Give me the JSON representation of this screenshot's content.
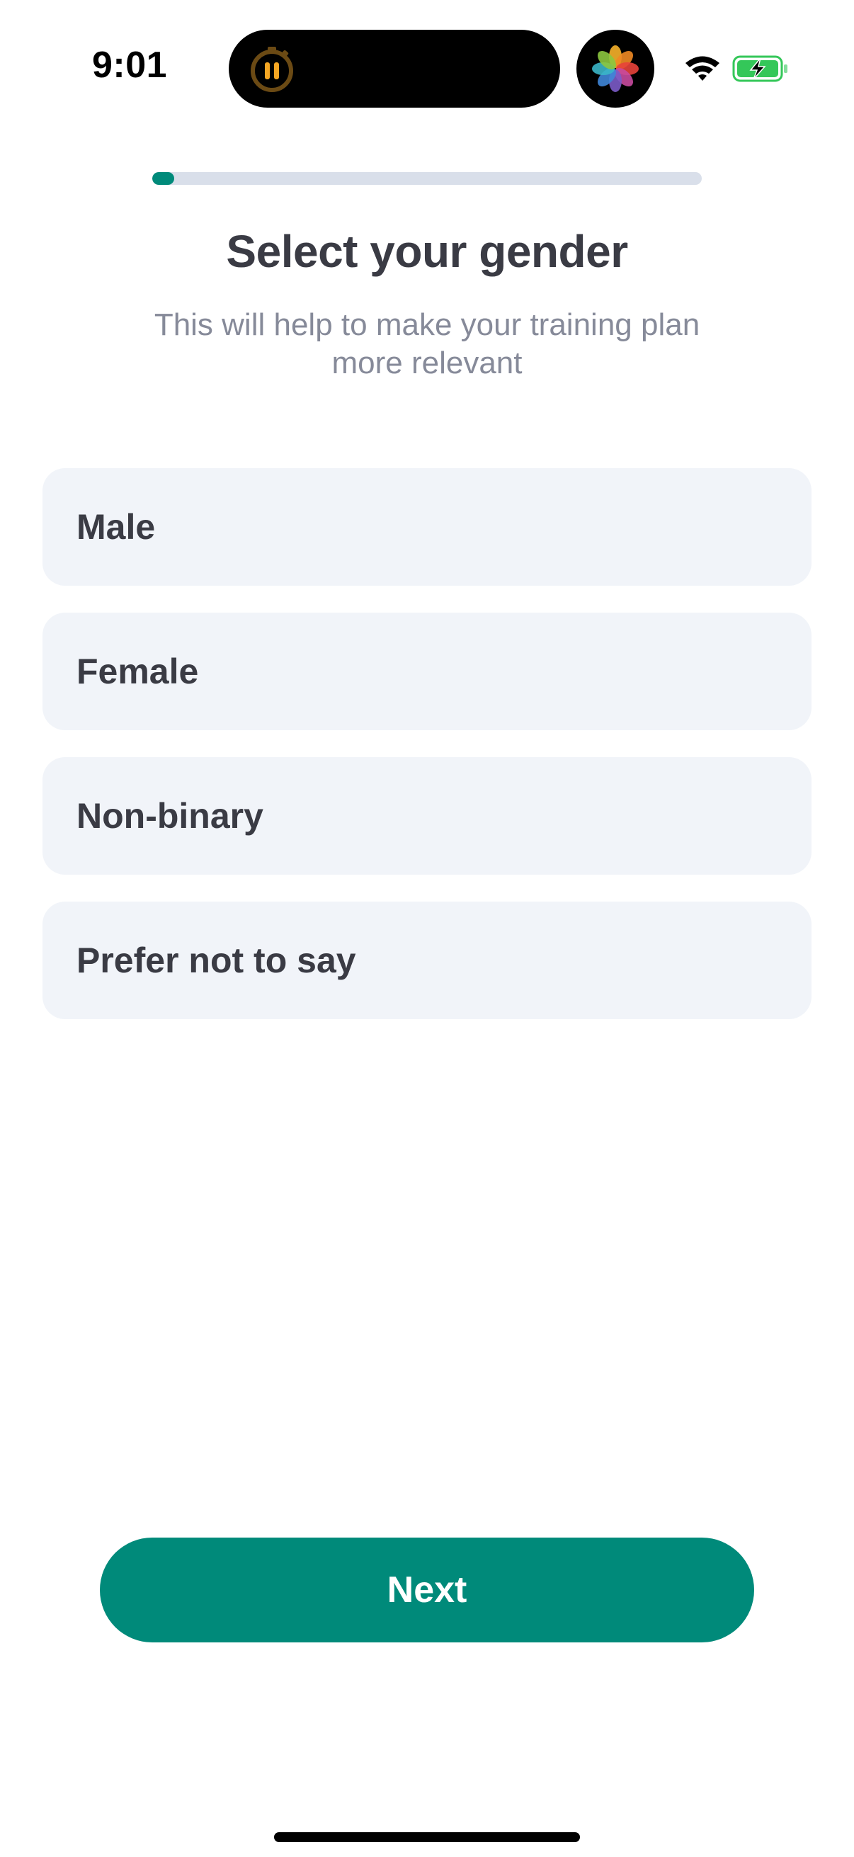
{
  "status_bar": {
    "time": "9:01",
    "activity_icon": "stopwatch-pause-icon",
    "app_icon": "photos-app-icon",
    "wifi_icon": "wifi-icon",
    "battery_icon": "battery-charging-icon"
  },
  "progress": {
    "fraction": 0.04,
    "accent_color": "#008a7a"
  },
  "header": {
    "title": "Select your gender",
    "subtitle": "This will help to make your training plan more relevant"
  },
  "options": [
    {
      "label": "Male"
    },
    {
      "label": "Female"
    },
    {
      "label": "Non-binary"
    },
    {
      "label": "Prefer not to say"
    }
  ],
  "footer": {
    "next_label": "Next"
  },
  "colors": {
    "accent": "#008a7a",
    "option_background": "#f1f4f9",
    "title_text": "#3a3b44",
    "subtitle_text": "#868a99"
  }
}
